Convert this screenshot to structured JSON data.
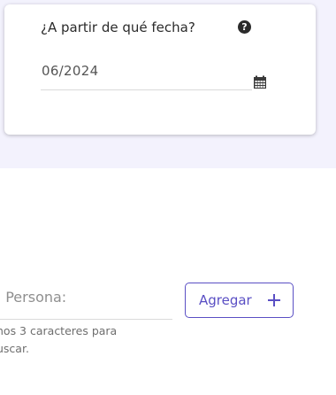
{
  "date_card": {
    "question": "¿A partir de qué fecha?",
    "date_value": "06/2024",
    "help_icon": "question-circle",
    "calendar_icon": "calendar"
  },
  "person_search": {
    "label": "n Persona:",
    "hint": "nos 3 caracteres para uscar.",
    "hint_line1": "nos 3 caracteres para",
    "hint_line2": "uscar."
  },
  "add_button": {
    "label": "Agregar",
    "icon": "plus-icon"
  },
  "colors": {
    "accent": "#5a4fc4",
    "band": "#f3f2fd"
  }
}
